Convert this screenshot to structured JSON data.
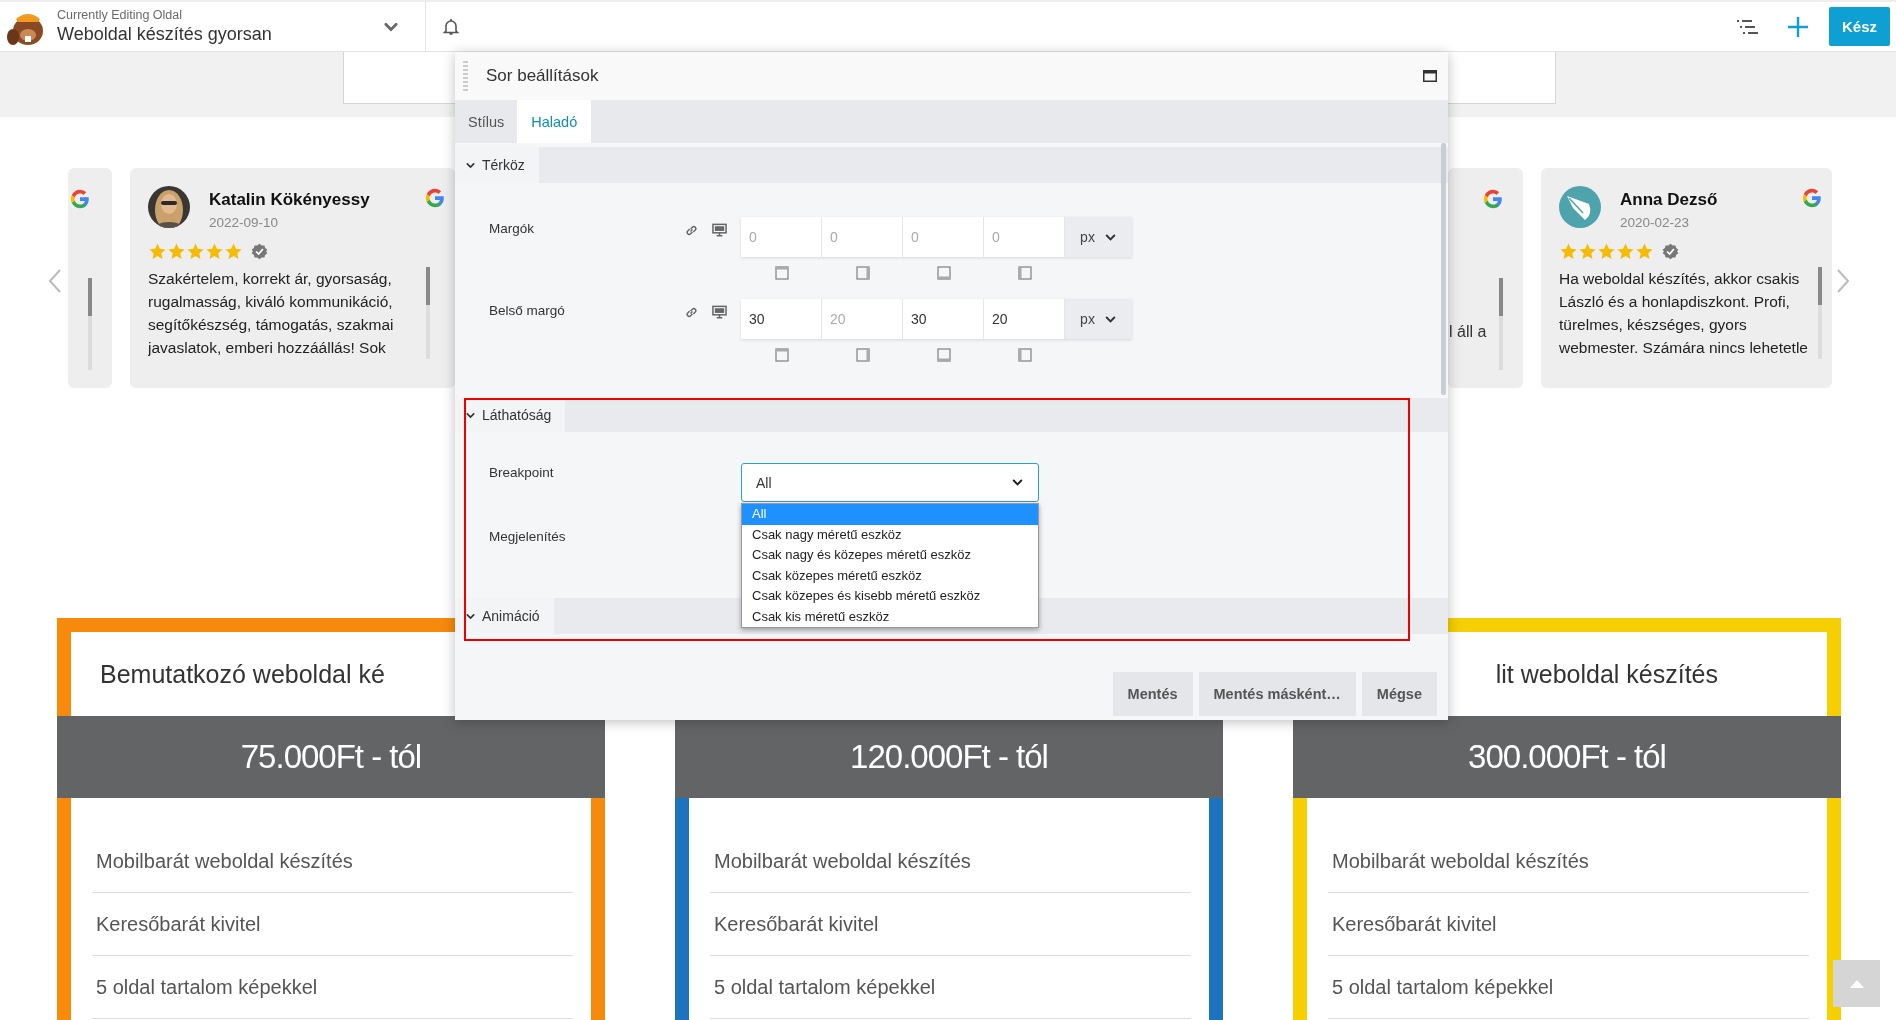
{
  "topbar": {
    "subtitle": "Currently Editing Oldal",
    "title": "Weboldal készítés gyorsan",
    "done_button": "Kész"
  },
  "reviews": [
    {
      "kind": "stub"
    },
    {
      "kind": "full",
      "name": "Katalin Kökényessy",
      "date": "2022-09-10",
      "stars": 5,
      "text": "Szakértelem, korrekt ár, gyorsaság, rugalmasság, kiváló kommunikáció, segítőkészség, támogatás, szakmai javaslatok, emberi hozzáállás! Sok"
    },
    {
      "kind": "stub",
      "text": "l áll a"
    },
    {
      "kind": "full",
      "avatar": {
        "kind": "logo"
      },
      "name": "Anna Dezső",
      "date": "2020-02-23",
      "stars": 5,
      "text": "Ha weboldal készítés, akkor csakis László és a honlapdiszkont. Profi, türelmes, készséges, gyors webmester. Számára nincs lehetetle"
    }
  ],
  "dialog": {
    "title": "Sor beállítások",
    "tabs": [
      {
        "label": "Stílus",
        "selected": false
      },
      {
        "label": "Haladó",
        "selected": true
      }
    ],
    "sections": [
      {
        "title": "Térköz",
        "fields": [
          {
            "kind": "dimension",
            "label": "Margók",
            "unit": "px",
            "inputs": [
              {
                "placeholder": "0"
              },
              {
                "placeholder": "0"
              },
              {
                "placeholder": "0"
              },
              {
                "placeholder": "0"
              }
            ]
          },
          {
            "kind": "dimension",
            "label": "Belső margó",
            "unit": "px",
            "inputs": [
              {
                "value": "30"
              },
              {
                "placeholder": "20"
              },
              {
                "value": "30"
              },
              {
                "value": "20"
              }
            ]
          }
        ]
      },
      {
        "title": "Láthatóság",
        "fields": [
          {
            "kind": "select",
            "label": "Breakpoint",
            "value": "All",
            "open": true,
            "options": [
              {
                "label": "All",
                "selected": true
              },
              {
                "label": "Csak nagy méretű eszköz",
                "selected": false
              },
              {
                "label": "Csak nagy és közepes méretű eszköz",
                "selected": false
              },
              {
                "label": "Csak közepes méretű eszköz",
                "selected": false
              },
              {
                "label": "Csak közepes és kisebb méretű eszköz",
                "selected": false
              },
              {
                "label": "Csak kis méretű eszköz",
                "selected": false
              }
            ]
          },
          {
            "kind": "label",
            "label": "Megjelenítés"
          }
        ]
      },
      {
        "title": "Animáció"
      }
    ],
    "buttons": [
      "Mentés",
      "Mentés másként…",
      "Mégse"
    ]
  },
  "pricing": [
    {
      "title": "Bemutatkozó weboldal ké",
      "price": "75.000Ft - tól",
      "color": "#f7890c",
      "features": [
        "Mobilbarát weboldal készítés",
        "Keresőbarát kivitel",
        "5 oldal tartalom képekkel"
      ]
    },
    {
      "price": "120.000Ft - tól",
      "color": "#1e73be",
      "features": [
        "Mobilbarát weboldal készítés",
        "Keresőbarát kivitel",
        "5 oldal tartalom képekkel"
      ]
    },
    {
      "title": "lit weboldal készítés",
      "price": "300.000Ft - tól",
      "color": "#f5cf00",
      "features": [
        "Mobilbarát weboldal készítés",
        "Keresőbarát kivitel",
        "5 oldal tartalom képekkel"
      ]
    }
  ]
}
